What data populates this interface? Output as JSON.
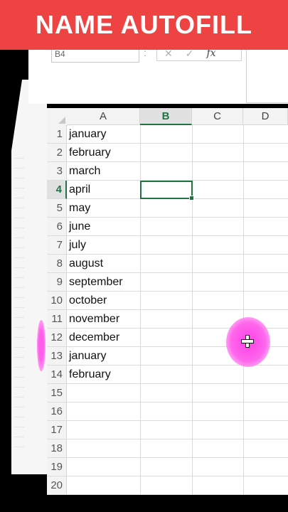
{
  "banner": {
    "title": "NAME AUTOFILL"
  },
  "formula_bar": {
    "namebox_value": "B4",
    "separator": ":",
    "cancel_glyph": "✕",
    "enter_glyph": "✓",
    "fx_label": "fx"
  },
  "columns": [
    "A",
    "B",
    "C",
    "D"
  ],
  "active_column": "B",
  "active_row": "4",
  "rows": [
    {
      "num": "1",
      "a": "january"
    },
    {
      "num": "2",
      "a": "february"
    },
    {
      "num": "3",
      "a": "march"
    },
    {
      "num": "4",
      "a": "april"
    },
    {
      "num": "5",
      "a": "may"
    },
    {
      "num": "6",
      "a": "june"
    },
    {
      "num": "7",
      "a": "july"
    },
    {
      "num": "8",
      "a": "august"
    },
    {
      "num": "9",
      "a": "september"
    },
    {
      "num": "10",
      "a": "october"
    },
    {
      "num": "11",
      "a": "november"
    },
    {
      "num": "12",
      "a": "december"
    },
    {
      "num": "13",
      "a": "january"
    },
    {
      "num": "14",
      "a": "february"
    },
    {
      "num": "15",
      "a": ""
    },
    {
      "num": "16",
      "a": ""
    },
    {
      "num": "17",
      "a": ""
    },
    {
      "num": "18",
      "a": ""
    },
    {
      "num": "19",
      "a": ""
    },
    {
      "num": "20",
      "a": ""
    }
  ],
  "colors": {
    "banner": "#ee4343",
    "accent_green": "#217346",
    "cursor_highlight": "#ff40e6"
  },
  "icons": {
    "cursor": "plus-cursor-icon"
  }
}
